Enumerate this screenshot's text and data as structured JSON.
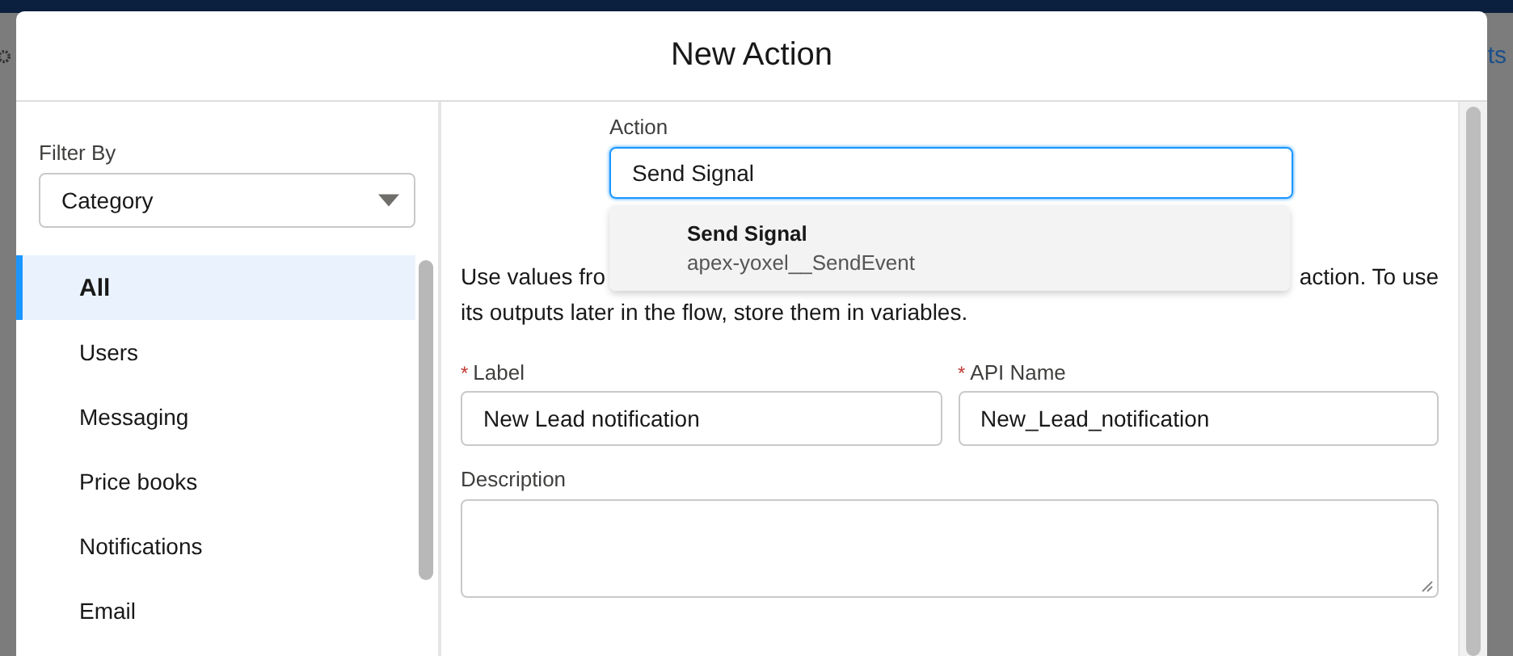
{
  "backdrop": {
    "link": "ts"
  },
  "modal": {
    "title": "New Action"
  },
  "filter": {
    "label": "Filter By",
    "value": "Category"
  },
  "categories": [
    {
      "label": "All",
      "selected": true
    },
    {
      "label": "Users",
      "selected": false
    },
    {
      "label": "Messaging",
      "selected": false
    },
    {
      "label": "Price books",
      "selected": false
    },
    {
      "label": "Notifications",
      "selected": false
    },
    {
      "label": "Email",
      "selected": false
    }
  ],
  "action": {
    "label": "Action",
    "value": "Send Signal",
    "focused": true,
    "suggestions": [
      {
        "title": "Send Signal",
        "subtitle": "apex-yoxel__SendEvent",
        "selected": true
      }
    ]
  },
  "help_text": {
    "line_1_start": "Use values fro",
    "line_1_end": "action. To use",
    "line_2": "its outputs later in the flow, store them in variables."
  },
  "fields": [
    {
      "label": "Label",
      "required": true,
      "required_mark": "*",
      "value": "New Lead notification"
    },
    {
      "label": "API Name",
      "required": true,
      "required_mark": "*",
      "value": "New_Lead_notification"
    }
  ],
  "description": {
    "label": "Description"
  }
}
